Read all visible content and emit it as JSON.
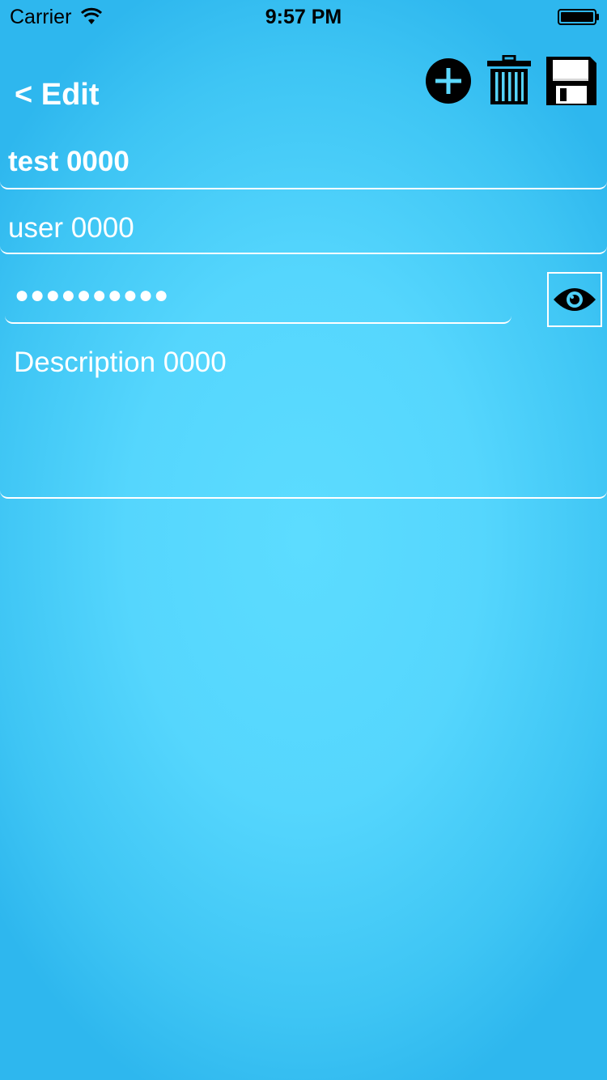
{
  "status_bar": {
    "carrier": "Carrier",
    "time": "9:57 PM",
    "wifi_icon": "wifi-icon",
    "battery_icon": "battery-full-icon"
  },
  "nav": {
    "back_label": "< Edit",
    "actions": [
      {
        "name": "add",
        "icon": "plus-circle-icon"
      },
      {
        "name": "delete",
        "icon": "trash-icon"
      },
      {
        "name": "save",
        "icon": "floppy-disk-icon"
      }
    ]
  },
  "form": {
    "title_value": "test 0000",
    "username_value": "user 0000",
    "password_masked": "●●●●●●●●●●",
    "show_password_icon": "eye-icon",
    "description_value": "Description 0000"
  },
  "colors": {
    "background_center": "#5cdcff",
    "background_edge": "#2eb7ee",
    "text": "#ffffff",
    "icons": "#000000"
  }
}
